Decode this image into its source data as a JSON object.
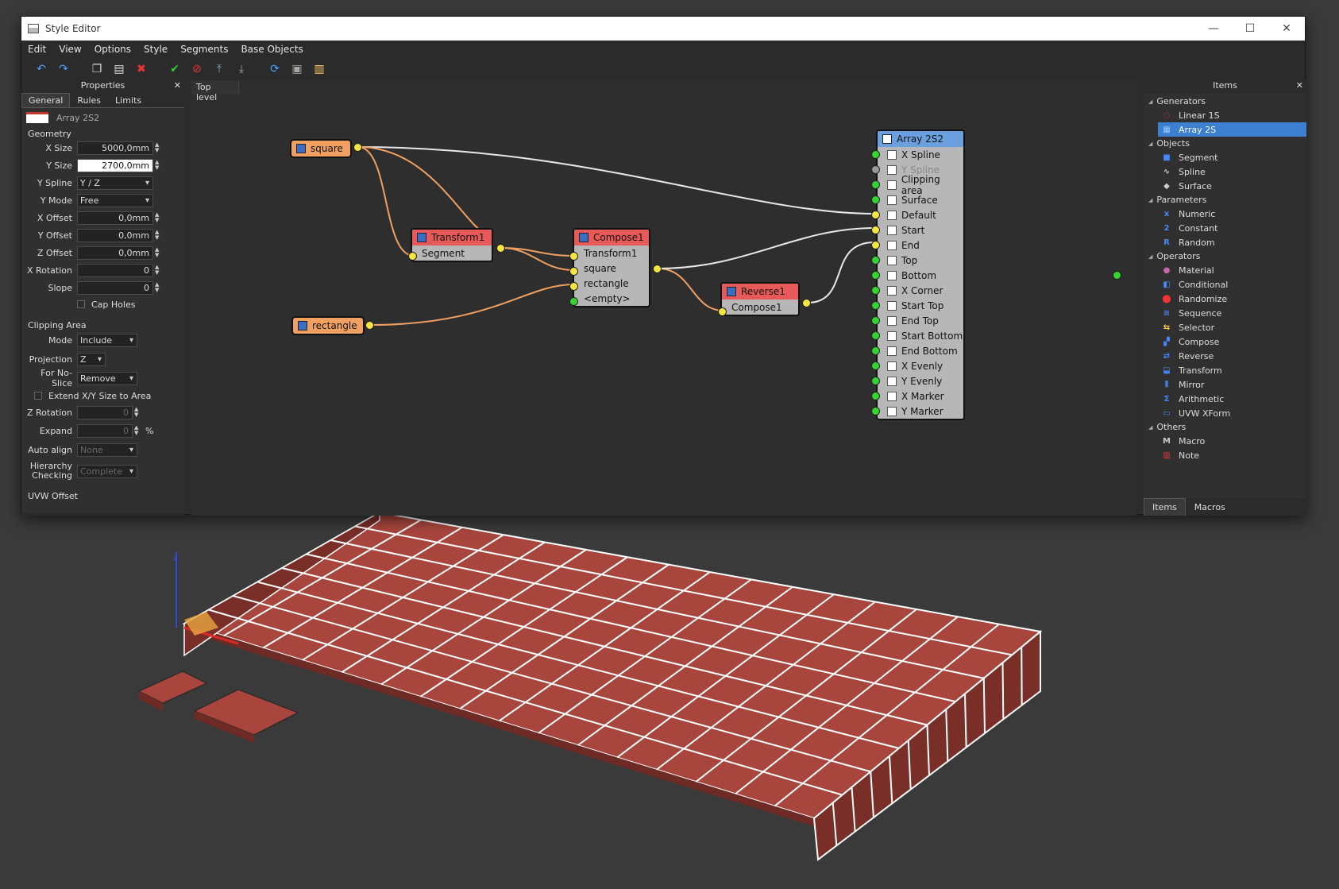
{
  "window": {
    "title": "Style Editor",
    "min": "—",
    "max": "☐",
    "close": "✕"
  },
  "menu": [
    "Edit",
    "View",
    "Options",
    "Style",
    "Segments",
    "Base Objects"
  ],
  "properties": {
    "title": "Properties",
    "tabs": [
      "General",
      "Rules",
      "Limits"
    ],
    "name": "Array 2S2",
    "geometry_title": "Geometry",
    "fields": [
      {
        "label": "X Size",
        "value": "5000,0mm"
      },
      {
        "label": "Y Size",
        "value": "2700,0mm"
      },
      {
        "label": "Y Spline",
        "value": "Y / Z"
      },
      {
        "label": "Y Mode",
        "value": "Free"
      },
      {
        "label": "X Offset",
        "value": "0,0mm"
      },
      {
        "label": "Y Offset",
        "value": "0,0mm"
      },
      {
        "label": "Z Offset",
        "value": "0,0mm"
      },
      {
        "label": "X Rotation",
        "value": "0"
      },
      {
        "label": "Slope",
        "value": "0"
      }
    ],
    "cap_holes": "Cap Holes",
    "clipping_title": "Clipping Area",
    "clip_fields": [
      {
        "label": "Mode",
        "value": "Include"
      },
      {
        "label": "Projection",
        "value": "Z"
      },
      {
        "label": "For No-Slice",
        "value": "Remove"
      }
    ],
    "extend": "Extend X/Y Size to Area",
    "z_rotation": {
      "label": "Z Rotation",
      "value": "0"
    },
    "expand": {
      "label": "Expand",
      "value": "0",
      "unit": "%"
    },
    "auto_align": {
      "label": "Auto align",
      "value": "None"
    },
    "hierarchy": {
      "label1": "Hierarchy",
      "label2": "Checking",
      "value": "Complete"
    },
    "uvw": "UVW Offset"
  },
  "canvas": {
    "tab": "Top level",
    "nodes": {
      "square": "square",
      "rectangle": "rectangle",
      "transform": {
        "title": "Transform1",
        "ports": [
          "Segment"
        ]
      },
      "compose": {
        "title": "Compose1",
        "ports": [
          "Transform1",
          "square",
          "rectangle",
          "<empty>"
        ]
      },
      "reverse": {
        "title": "Reverse1",
        "ports": [
          "Compose1"
        ]
      },
      "array": {
        "title": "Array 2S2",
        "ports": [
          "X Spline",
          "Y Spline",
          "Clipping area",
          "Surface",
          "Default",
          "Start",
          "End",
          "Top",
          "Bottom",
          "X Corner",
          "Start Top",
          "End Top",
          "Start Bottom",
          "End Bottom",
          "X Evenly",
          "Y Evenly",
          "X Marker",
          "Y Marker"
        ]
      }
    }
  },
  "items": {
    "title": "Items",
    "categories": [
      {
        "name": "Generators",
        "items": [
          {
            "label": "Linear 1S",
            "icon": "linear-icon"
          },
          {
            "label": "Array 2S",
            "icon": "array-icon"
          }
        ]
      },
      {
        "name": "Objects",
        "items": [
          {
            "label": "Segment",
            "icon": "segment-icon"
          },
          {
            "label": "Spline",
            "icon": "spline-icon"
          },
          {
            "label": "Surface",
            "icon": "surface-icon"
          }
        ]
      },
      {
        "name": "Parameters",
        "items": [
          {
            "label": "Numeric",
            "icon": "numeric-icon"
          },
          {
            "label": "Constant",
            "icon": "constant-icon"
          },
          {
            "label": "Random",
            "icon": "random-icon"
          }
        ]
      },
      {
        "name": "Operators",
        "items": [
          {
            "label": "Material",
            "icon": "material-icon"
          },
          {
            "label": "Conditional",
            "icon": "conditional-icon"
          },
          {
            "label": "Randomize",
            "icon": "randomize-icon"
          },
          {
            "label": "Sequence",
            "icon": "sequence-icon"
          },
          {
            "label": "Selector",
            "icon": "selector-icon"
          },
          {
            "label": "Compose",
            "icon": "compose-icon"
          },
          {
            "label": "Reverse",
            "icon": "reverse-icon"
          },
          {
            "label": "Transform",
            "icon": "transform-icon"
          },
          {
            "label": "Mirror",
            "icon": "mirror-icon"
          },
          {
            "label": "Arithmetic",
            "icon": "arithmetic-icon"
          },
          {
            "label": "UVW XForm",
            "icon": "uvw-icon"
          }
        ]
      },
      {
        "name": "Others",
        "items": [
          {
            "label": "Macro",
            "icon": "macro-icon"
          },
          {
            "label": "Note",
            "icon": "note-icon"
          }
        ]
      }
    ],
    "tabs": [
      "Items",
      "Macros"
    ]
  },
  "colors": {
    "tile": "#a8463e",
    "grout": "#ffffff",
    "node_red": "#e85a5a",
    "node_orange": "#f0a060",
    "pin_yellow": "#f5e642",
    "pin_green": "#34d434"
  }
}
